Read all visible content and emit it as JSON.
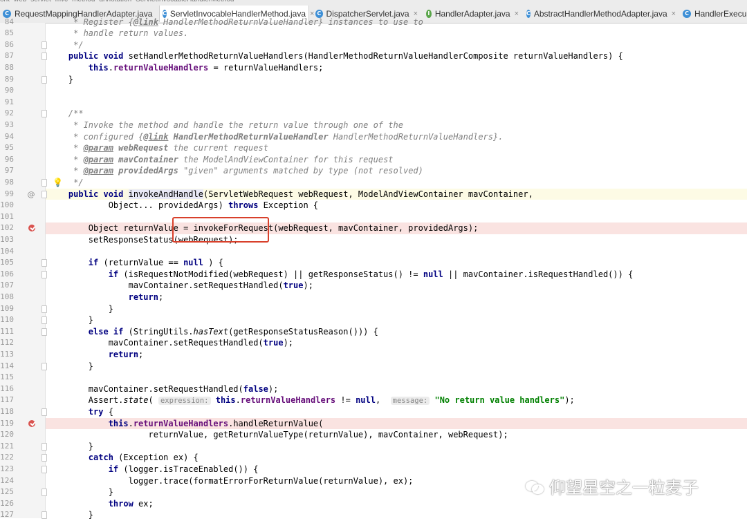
{
  "breadcrumbs": [
    "ork",
    "web",
    "servlet",
    "mvc",
    "method",
    "annotation",
    "ServletInvocableHandlerMethod"
  ],
  "tabs": [
    {
      "label": "RequestMappingHandlerAdapter.java",
      "icon": "class-icon",
      "active": false,
      "closable": false
    },
    {
      "label": "ServletInvocableHandlerMethod.java",
      "icon": "class-icon",
      "active": true,
      "closable": true
    },
    {
      "label": "DispatcherServlet.java",
      "icon": "class-icon",
      "active": false,
      "closable": true
    },
    {
      "label": "HandlerAdapter.java",
      "icon": "interface-icon",
      "active": false,
      "closable": true
    },
    {
      "label": "AbstractHandlerMethodAdapter.java",
      "icon": "class-icon",
      "active": false,
      "closable": true
    },
    {
      "label": "HandlerExecu",
      "icon": "class-icon",
      "active": false,
      "closable": false
    }
  ],
  "close_glyph": "×",
  "lines": [
    {
      "n": "84",
      "segs": [
        [
          "cm",
          "     * Register {"
        ],
        [
          "cmb",
          "@link"
        ],
        [
          "cm",
          " HandlerMethodReturnValueHandler} instances to use to"
        ]
      ]
    },
    {
      "n": "85",
      "segs": [
        [
          "cm",
          "     * handle return values."
        ]
      ]
    },
    {
      "n": "86",
      "segs": [
        [
          "cm",
          "     */"
        ]
      ],
      "fold": true
    },
    {
      "n": "87",
      "segs": [
        [
          "kw",
          "    public void "
        ],
        [
          "",
          "setHandlerMethodReturnValueHandlers(HandlerMethodReturnValueHandlerComposite returnValueHandlers) {"
        ]
      ],
      "fold": true
    },
    {
      "n": "88",
      "segs": [
        [
          "kw",
          "        this"
        ],
        [
          "",
          "."
        ],
        [
          "fd",
          "returnValueHandlers"
        ],
        [
          "",
          " = returnValueHandlers;"
        ]
      ]
    },
    {
      "n": "89",
      "segs": [
        [
          "",
          "    }"
        ]
      ],
      "fold": true
    },
    {
      "n": "90",
      "segs": []
    },
    {
      "n": "91",
      "segs": []
    },
    {
      "n": "92",
      "segs": [
        [
          "cm",
          "    /**"
        ]
      ],
      "fold": true
    },
    {
      "n": "93",
      "segs": [
        [
          "cm",
          "     * Invoke the method and handle the return value through one of the"
        ]
      ]
    },
    {
      "n": "94",
      "segs": [
        [
          "cm",
          "     * configured {"
        ],
        [
          "cmb",
          "@link"
        ],
        [
          "cmt",
          " HandlerMethodReturnValueHandler"
        ],
        [
          "cm",
          " HandlerMethodReturnValueHandlers}."
        ]
      ]
    },
    {
      "n": "95",
      "segs": [
        [
          "cm",
          "     * "
        ],
        [
          "cmb",
          "@param"
        ],
        [
          "cmt",
          " webRequest"
        ],
        [
          "cm",
          " the current request"
        ]
      ]
    },
    {
      "n": "96",
      "segs": [
        [
          "cm",
          "     * "
        ],
        [
          "cmb",
          "@param"
        ],
        [
          "cmt",
          " mavContainer"
        ],
        [
          "cm",
          " the ModelAndViewContainer for this request"
        ]
      ]
    },
    {
      "n": "97",
      "segs": [
        [
          "cm",
          "     * "
        ],
        [
          "cmb",
          "@param"
        ],
        [
          "cmt",
          " providedArgs"
        ],
        [
          "cm",
          " \"given\" arguments matched by type (not resolved)"
        ]
      ]
    },
    {
      "n": "98",
      "segs": [
        [
          "cm",
          "     */"
        ]
      ],
      "fold": true,
      "bulb": true
    },
    {
      "n": "99",
      "segs": [
        [
          "kw",
          "    public void "
        ],
        [
          "mhl",
          "invokeAndHandle"
        ],
        [
          "",
          "(ServletWebRequest webRequest, ModelAndViewContainer mavContainer,"
        ]
      ],
      "at": true,
      "fold": true,
      "cur": true
    },
    {
      "n": "100",
      "segs": [
        [
          "",
          "            Object... providedArgs) "
        ],
        [
          "kw",
          "throws"
        ],
        [
          "",
          " Exception {"
        ]
      ]
    },
    {
      "n": "101",
      "segs": []
    },
    {
      "n": "102",
      "segs": [
        [
          "",
          "        Object returnValue = invokeForRequest(webRequest, mavContainer, providedArgs);"
        ]
      ],
      "bp": true
    },
    {
      "n": "103",
      "segs": [
        [
          "",
          "        setResponseStatus(webRequest);"
        ]
      ]
    },
    {
      "n": "104",
      "segs": []
    },
    {
      "n": "105",
      "segs": [
        [
          "kw",
          "        if"
        ],
        [
          "",
          " (returnValue == "
        ],
        [
          "kw",
          "null"
        ],
        [
          "",
          " ) {"
        ]
      ],
      "fold": true
    },
    {
      "n": "106",
      "segs": [
        [
          "kw",
          "            if"
        ],
        [
          "",
          " (isRequestNotModified(webRequest) || getResponseStatus() != "
        ],
        [
          "kw",
          "null"
        ],
        [
          "",
          " || mavContainer.isRequestHandled()) {"
        ]
      ],
      "fold": true
    },
    {
      "n": "107",
      "segs": [
        [
          "",
          "                mavContainer.setRequestHandled("
        ],
        [
          "kw",
          "true"
        ],
        [
          "",
          ");"
        ]
      ]
    },
    {
      "n": "108",
      "segs": [
        [
          "kw",
          "                return"
        ],
        [
          "",
          ";"
        ]
      ]
    },
    {
      "n": "109",
      "segs": [
        [
          "",
          "            }"
        ]
      ],
      "fold": true
    },
    {
      "n": "110",
      "segs": [
        [
          "",
          "        }"
        ]
      ],
      "fold": true
    },
    {
      "n": "111",
      "segs": [
        [
          "kw",
          "        else if"
        ],
        [
          "",
          " (StringUtils."
        ],
        [
          "it",
          "hasText"
        ],
        [
          "",
          "(getResponseStatusReason())) {"
        ]
      ],
      "fold": true
    },
    {
      "n": "112",
      "segs": [
        [
          "",
          "            mavContainer.setRequestHandled("
        ],
        [
          "kw",
          "true"
        ],
        [
          "",
          ");"
        ]
      ]
    },
    {
      "n": "113",
      "segs": [
        [
          "kw",
          "            return"
        ],
        [
          "",
          ";"
        ]
      ]
    },
    {
      "n": "114",
      "segs": [
        [
          "",
          "        }"
        ]
      ],
      "fold": true
    },
    {
      "n": "115",
      "segs": []
    },
    {
      "n": "116",
      "segs": [
        [
          "",
          "        mavContainer.setRequestHandled("
        ],
        [
          "kw",
          "false"
        ],
        [
          "",
          ");"
        ]
      ]
    },
    {
      "n": "117",
      "segs": [
        [
          "",
          "        Assert."
        ],
        [
          "it",
          "state"
        ],
        [
          "",
          "( "
        ],
        [
          "hint",
          "expression:"
        ],
        [
          "",
          " "
        ],
        [
          "kw",
          "this"
        ],
        [
          "",
          "."
        ],
        [
          "fd",
          "returnValueHandlers"
        ],
        [
          "",
          " != "
        ],
        [
          "kw",
          "null"
        ],
        [
          "",
          ",  "
        ],
        [
          "hint",
          "message:"
        ],
        [
          "",
          " "
        ],
        [
          "st",
          "\"No return value handlers\""
        ],
        [
          "",
          ");"
        ]
      ]
    },
    {
      "n": "118",
      "segs": [
        [
          "kw",
          "        try"
        ],
        [
          "",
          " {"
        ]
      ],
      "fold": true
    },
    {
      "n": "119",
      "segs": [
        [
          "kw",
          "            this"
        ],
        [
          "",
          "."
        ],
        [
          "fd",
          "returnValueHandlers"
        ],
        [
          "",
          ".handleReturnValue("
        ]
      ],
      "bp": true
    },
    {
      "n": "120",
      "segs": [
        [
          "",
          "                    returnValue, getReturnValueType(returnValue), mavContainer, webRequest);"
        ]
      ]
    },
    {
      "n": "121",
      "segs": [
        [
          "",
          "        }"
        ]
      ],
      "fold": true
    },
    {
      "n": "122",
      "segs": [
        [
          "kw",
          "        catch"
        ],
        [
          "",
          " (Exception ex) {"
        ]
      ],
      "fold": true
    },
    {
      "n": "123",
      "segs": [
        [
          "kw",
          "            if"
        ],
        [
          "",
          " (logger.isTraceEnabled()) {"
        ]
      ],
      "fold": true
    },
    {
      "n": "124",
      "segs": [
        [
          "",
          "                logger.trace(formatErrorForReturnValue(returnValue), ex);"
        ]
      ]
    },
    {
      "n": "125",
      "segs": [
        [
          "",
          "            }"
        ]
      ],
      "fold": true
    },
    {
      "n": "126",
      "segs": [
        [
          "kw",
          "            throw"
        ],
        [
          "",
          " ex;"
        ]
      ]
    },
    {
      "n": "127",
      "segs": [
        [
          "",
          "        }"
        ]
      ],
      "fold": true
    }
  ],
  "gutter_at_glyph": "@",
  "watermark": {
    "text": "仰望星空之一粒麦子",
    "icon": "wechat-icon"
  },
  "colors": {
    "keyword": "#000080",
    "comment": "#808080",
    "field": "#660e7a",
    "string": "#008000",
    "breakpoint": "#d9534f",
    "highlight_box": "#d8402b"
  }
}
